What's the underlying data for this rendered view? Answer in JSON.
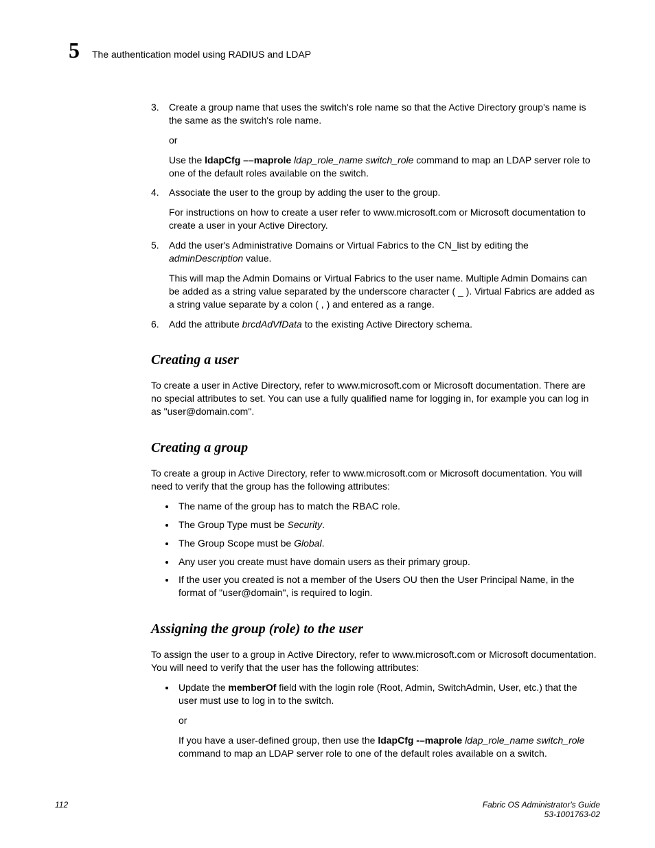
{
  "header": {
    "chapter_number": "5",
    "title": "The authentication model using RADIUS and LDAP"
  },
  "steps": {
    "s3": {
      "num": "3.",
      "text_a": "Create a group name that uses the switch's role name so that the Active Directory group's name is the same as the switch's role name.",
      "or": "or",
      "use_the": "Use the ",
      "cmd_bold": "ldapCfg ––maprole",
      "cmd_ital": " ldap_role_name switch_role",
      "tail": " command to map an LDAP server role to one of the default roles available on the switch."
    },
    "s4": {
      "num": "4.",
      "text_a": "Associate the user to the group by adding the user to the group.",
      "text_b": "For instructions on how to create a user refer to www.microsoft.com or Microsoft documentation to create a user in your Active Directory."
    },
    "s5": {
      "num": "5.",
      "text_a1": "Add the user's Administrative Domains or Virtual Fabrics to the CN_list by editing the ",
      "ital": "adminDescription",
      "text_a2": " value.",
      "text_b": "This will map the Admin Domains or Virtual Fabrics to the user name. Multiple Admin Domains can be added as a string value separated by the underscore character ( _ ). Virtual Fabrics are added as a string value separate by a colon ( , ) and entered as a range."
    },
    "s6": {
      "num": "6.",
      "pre": "Add the attribute ",
      "ital": "brcdAdVfData",
      "post": " to the existing Active Directory schema."
    }
  },
  "section_user": {
    "heading": "Creating a user",
    "body": "To create a user in Active Directory, refer to www.microsoft.com or Microsoft documentation. There are no special attributes to set. You can use a fully qualified name for logging in, for example you can log in as \"user@domain.com\"."
  },
  "section_group": {
    "heading": "Creating a group",
    "body": "To create a group in Active Directory, refer to www.microsoft.com or Microsoft documentation. You will need to verify that the group has the following attributes:",
    "bullets": {
      "b1": "The name of the group has to match the RBAC role.",
      "b2_pre": "The Group Type must be ",
      "b2_ital": "Security",
      "b2_post": ".",
      "b3_pre": "The Group Scope must be ",
      "b3_ital": "Global",
      "b3_post": ".",
      "b4": "Any user you create must have domain users as their primary group.",
      "b5": "If the user you created is not a member of the Users OU then the User Principal Name, in the format of \"user@domain\", is required to login."
    }
  },
  "section_assign": {
    "heading": "Assigning the group (role) to the user",
    "body": "To assign the user to a group in Active Directory, refer to www.microsoft.com or Microsoft documentation. You will need to verify that the user has the following attributes:",
    "bullet1_pre": "Update the ",
    "bullet1_bold": "memberOf",
    "bullet1_post": " field with the login role (Root, Admin, SwitchAdmin, User, etc.) that the user must use to log in to the switch.",
    "or": "or",
    "b2_pre": "If you have a user-defined group, then use the ",
    "b2_bold": "ldapCfg -–maprole",
    "b2_ital": " ldap_role_name switch_role",
    "b2_post": " command to map an LDAP server role to one of the default roles available on a switch."
  },
  "footer": {
    "page": "112",
    "title": "Fabric OS Administrator's Guide",
    "docnum": "53-1001763-02"
  }
}
